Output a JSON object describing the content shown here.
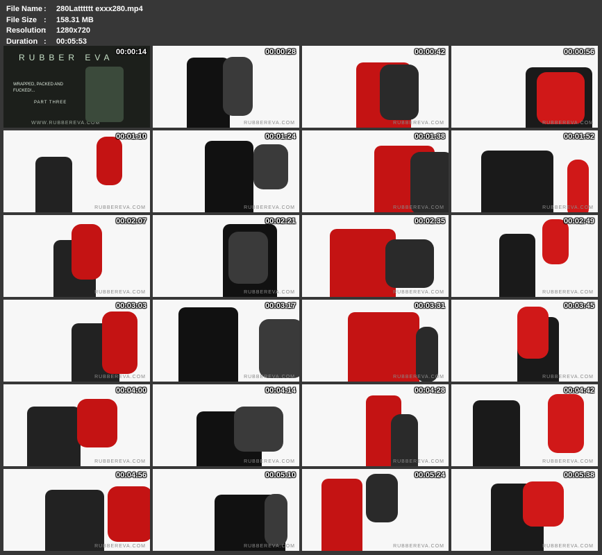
{
  "meta": [
    {
      "key": "File Name",
      "value": "280Latttttt exxx280.mp4"
    },
    {
      "key": "File Size",
      "value": "158.31 MB"
    },
    {
      "key": "Resolution",
      "value": "1280x720"
    },
    {
      "key": "Duration",
      "value": "00:05:53"
    }
  ],
  "separator": ":",
  "title_card": {
    "brand": "RUBBER EVA",
    "subtitle": "WRAPPED, PACKED AND FUCKED!...",
    "part": "PART THREE",
    "url": "WWW.RUBBEREVA.COM"
  },
  "watermark": "RUBBEREVA.COM",
  "thumbnails": [
    {
      "time": "00:00:14",
      "style": "dark"
    },
    {
      "time": "00:00:28",
      "style": "light"
    },
    {
      "time": "00:00:42",
      "style": "light"
    },
    {
      "time": "00:00:56",
      "style": "light"
    },
    {
      "time": "00:01:10",
      "style": "light"
    },
    {
      "time": "00:01:24",
      "style": "light"
    },
    {
      "time": "00:01:38",
      "style": "light"
    },
    {
      "time": "00:01:52",
      "style": "light"
    },
    {
      "time": "00:02:07",
      "style": "light"
    },
    {
      "time": "00:02:21",
      "style": "light"
    },
    {
      "time": "00:02:35",
      "style": "light"
    },
    {
      "time": "00:02:49",
      "style": "light"
    },
    {
      "time": "00:03:03",
      "style": "light"
    },
    {
      "time": "00:03:17",
      "style": "light"
    },
    {
      "time": "00:03:31",
      "style": "light"
    },
    {
      "time": "00:03:45",
      "style": "light"
    },
    {
      "time": "00:04:00",
      "style": "light"
    },
    {
      "time": "00:04:14",
      "style": "light"
    },
    {
      "time": "00:04:28",
      "style": "light"
    },
    {
      "time": "00:04:42",
      "style": "light"
    },
    {
      "time": "00:04:56",
      "style": "light"
    },
    {
      "time": "00:05:10",
      "style": "light"
    },
    {
      "time": "00:05:24",
      "style": "light"
    },
    {
      "time": "00:05:38",
      "style": "light"
    }
  ]
}
